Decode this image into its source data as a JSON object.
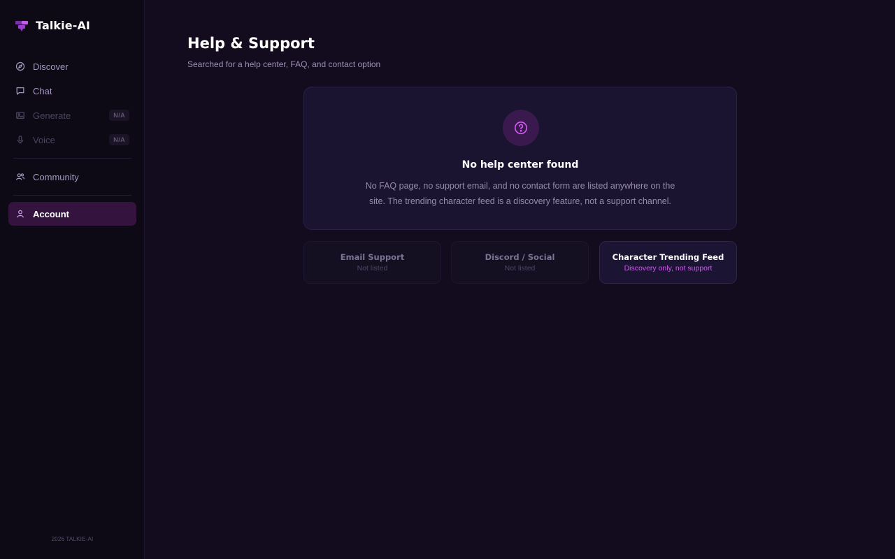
{
  "app": {
    "name": "Talkie-AI",
    "footer": "2026 TALKIE-AI"
  },
  "sidebar": {
    "items": [
      {
        "label": "Discover",
        "icon": "compass-icon",
        "state": "normal"
      },
      {
        "label": "Chat",
        "icon": "chat-bubble-icon",
        "state": "normal"
      },
      {
        "label": "Generate",
        "icon": "image-icon",
        "state": "disabled",
        "badge": "N/A"
      },
      {
        "label": "Voice",
        "icon": "microphone-icon",
        "state": "disabled",
        "badge": "N/A"
      },
      {
        "label": "Community",
        "icon": "users-icon",
        "state": "normal"
      },
      {
        "label": "Account",
        "icon": "user-icon",
        "state": "active"
      }
    ]
  },
  "main": {
    "title": "Help & Support",
    "subtitle": "Searched for a help center, FAQ, and contact option",
    "empty_state": {
      "icon": "question-circle-icon",
      "title": "No help center found",
      "description": "No FAQ page, no support email, and no contact form are listed anywhere on the site. The trending character feed is a discovery feature, not a support channel."
    },
    "options": [
      {
        "title": "Email Support",
        "subtitle": "Not listed",
        "style": "muted"
      },
      {
        "title": "Discord / Social",
        "subtitle": "Not listed",
        "style": "muted"
      },
      {
        "title": "Character Trending Feed",
        "subtitle": "Discovery only, not support",
        "style": "highlight"
      }
    ]
  },
  "colors": {
    "background": "#130c1f",
    "sidebar": "#0d0915",
    "accent": "#d25af0",
    "active_nav": "#34143f"
  }
}
